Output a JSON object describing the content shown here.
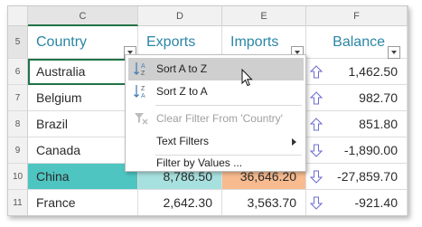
{
  "columns": [
    {
      "id": "C",
      "label": "C"
    },
    {
      "id": "D",
      "label": "D"
    },
    {
      "id": "E",
      "label": "E"
    },
    {
      "id": "F",
      "label": "F"
    }
  ],
  "header_row": {
    "row_number": "5",
    "country": "Country",
    "exports": "Exports",
    "imports": "Imports",
    "balance": "Balance"
  },
  "rows": [
    {
      "row": "6",
      "country": "Australia",
      "exports": "",
      "imports": "",
      "balance": "1,462.50",
      "trend": "up"
    },
    {
      "row": "7",
      "country": "Belgium",
      "exports": "",
      "imports": "",
      "balance": "982.70",
      "trend": "up"
    },
    {
      "row": "8",
      "country": "Brazil",
      "exports": "",
      "imports": "",
      "balance": "851.80",
      "trend": "up"
    },
    {
      "row": "9",
      "country": "Canada",
      "exports": "",
      "imports": "",
      "balance": "-1,890.00",
      "trend": "down"
    },
    {
      "row": "10",
      "country": "China",
      "exports": "8,786.50",
      "imports": "36,646.20",
      "balance": "-27,859.70",
      "trend": "down"
    },
    {
      "row": "11",
      "country": "France",
      "exports": "2,642.30",
      "imports": "3,563.70",
      "balance": "-921.40",
      "trend": "down"
    }
  ],
  "filter_menu": {
    "items": [
      {
        "label": "Sort A to Z",
        "icon": "sort-az-icon",
        "highlighted": true,
        "disabled": false
      },
      {
        "label": "Sort Z to A",
        "icon": "sort-za-icon",
        "highlighted": false,
        "disabled": false
      },
      {
        "label": "Clear Filter From 'Country'",
        "icon": "clear-filter-icon",
        "highlighted": false,
        "disabled": true
      },
      {
        "label": "Text Filters",
        "icon": "",
        "highlighted": false,
        "disabled": false,
        "submenu": true
      },
      {
        "label": "Filter by Values ...",
        "icon": "",
        "highlighted": false,
        "disabled": false
      }
    ]
  },
  "colors": {
    "header_text": "#2a86a6",
    "china_country_fill": "#4ec5c1",
    "china_exports_fill": "#a7e1df",
    "china_imports_fill": "#f7bb8f",
    "menu_highlight": "#cfcfcf",
    "arrow_stroke": "#6c6ccf"
  }
}
